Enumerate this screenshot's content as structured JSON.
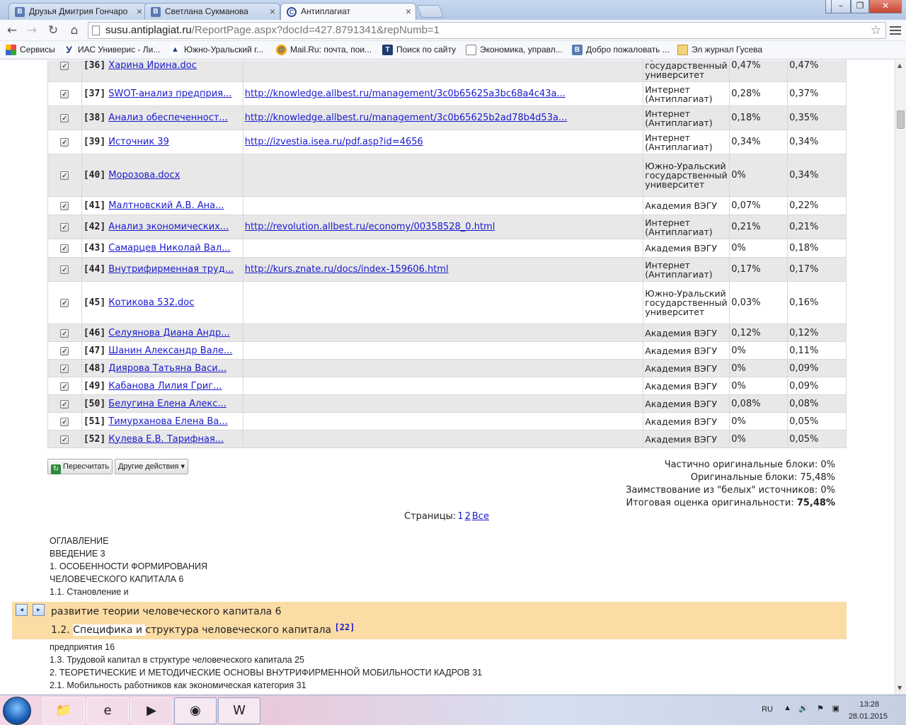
{
  "browser": {
    "tabs": [
      {
        "title": "Друзья Дмитрия Гончаро",
        "icon": "vk-icon",
        "active": false
      },
      {
        "title": "Светлана Сукманова",
        "icon": "vk-icon",
        "active": false
      },
      {
        "title": "Антиплагиат",
        "icon": "antiplagiat-icon",
        "active": true
      }
    ],
    "url_host": "susu.antiplagiat.ru",
    "url_path": "/ReportPage.aspx?docId=427.8791341&repNumb=1",
    "bookmarks": [
      {
        "label": "Сервисы",
        "icon": "apps-icon"
      },
      {
        "label": "ИАС Универис - Ли...",
        "icon": "yandex-icon"
      },
      {
        "label": "Южно-Уральский г...",
        "icon": "susu-icon"
      },
      {
        "label": "Mail.Ru: почта, пои...",
        "icon": "mailru-icon"
      },
      {
        "label": "Поиск по сайту",
        "icon": "t-icon"
      },
      {
        "label": "Экономика, управл...",
        "icon": "page-icon"
      },
      {
        "label": "Добро пожаловать ...",
        "icon": "vk-icon"
      },
      {
        "label": "Эл журнал Гусева",
        "icon": "folder-icon"
      }
    ]
  },
  "sources": [
    {
      "num": "[36]",
      "name": "Харина Ирина.doc",
      "url": "",
      "collection": "Уральский государственный университет",
      "share": "0,47%",
      "total": "0,47%",
      "alt": true
    },
    {
      "num": "[37]",
      "name": "SWOT-анализ предприя...",
      "url": "http://knowledge.allbest.ru/management/3c0b65625a3bc68a4c43a...",
      "collection": "Интернет (Антиплагиат)",
      "share": "0,28%",
      "total": "0,37%",
      "alt": false
    },
    {
      "num": "[38]",
      "name": "Анализ обеспеченност...",
      "url": "http://knowledge.allbest.ru/management/3c0b65625b2ad78b4d53a...",
      "collection": "Интернет (Антиплагиат)",
      "share": "0,18%",
      "total": "0,35%",
      "alt": true
    },
    {
      "num": "[39]",
      "name": "Источник 39",
      "url": "http://izvestia.isea.ru/pdf.asp?id=4656",
      "collection": "Интернет (Антиплагиат)",
      "share": "0,34%",
      "total": "0,34%",
      "alt": false
    },
    {
      "num": "[40]",
      "name": "Морозова.docx",
      "url": "",
      "collection": "Южно-Уральский государственный университет",
      "share": "0%",
      "total": "0,34%",
      "alt": true
    },
    {
      "num": "[41]",
      "name": "Малтновский А.В.  Ана...",
      "url": "",
      "collection": "Академия ВЭГУ",
      "share": "0,07%",
      "total": "0,22%",
      "alt": false
    },
    {
      "num": "[42]",
      "name": "Анализ экономических...",
      "url": "http://revolution.allbest.ru/economy/00358528_0.html",
      "collection": "Интернет (Антиплагиат)",
      "share": "0,21%",
      "total": "0,21%",
      "alt": true
    },
    {
      "num": "[43]",
      "name": "Самарцев Николай Вал...",
      "url": "",
      "collection": "Академия ВЭГУ",
      "share": "0%",
      "total": "0,18%",
      "alt": false
    },
    {
      "num": "[44]",
      "name": "Внутрифирменная труд...",
      "url": "http://kurs.znate.ru/docs/index-159606.html",
      "collection": "Интернет (Антиплагиат)",
      "share": "0,17%",
      "total": "0,17%",
      "alt": true
    },
    {
      "num": "[45]",
      "name": "Котикова 532.doc",
      "url": "",
      "collection": "Южно-Уральский государственный университет",
      "share": "0,03%",
      "total": "0,16%",
      "alt": false
    },
    {
      "num": "[46]",
      "name": "Селуянова Диана Андр...",
      "url": "",
      "collection": "Академия ВЭГУ",
      "share": "0,12%",
      "total": "0,12%",
      "alt": true
    },
    {
      "num": "[47]",
      "name": "Шанин Александр Вале...",
      "url": "",
      "collection": "Академия ВЭГУ",
      "share": "0%",
      "total": "0,11%",
      "alt": false
    },
    {
      "num": "[48]",
      "name": "Диярова Татьяна Васи...",
      "url": "",
      "collection": "Академия ВЭГУ",
      "share": "0%",
      "total": "0,09%",
      "alt": true
    },
    {
      "num": "[49]",
      "name": "Кабанова Лилия Григ...",
      "url": "",
      "collection": "Академия ВЭГУ",
      "share": "0%",
      "total": "0,09%",
      "alt": false
    },
    {
      "num": "[50]",
      "name": "Белугина Елена Алекс...",
      "url": "",
      "collection": "Академия ВЭГУ",
      "share": "0,08%",
      "total": "0,08%",
      "alt": true
    },
    {
      "num": "[51]",
      "name": "Тимурханова Елена Ва...",
      "url": "",
      "collection": "Академия ВЭГУ",
      "share": "0%",
      "total": "0,05%",
      "alt": false
    },
    {
      "num": "[52]",
      "name": "Кулева Е.В.  Тарифная...",
      "url": "",
      "collection": "Академия ВЭГУ",
      "share": "0%",
      "total": "0,05%",
      "alt": true
    }
  ],
  "actions": {
    "recalc": "Пересчитать",
    "other": "Другие действия"
  },
  "stats": {
    "partial_label": "Частично оригинальные блоки:",
    "partial_value": "0%",
    "original_label": "Оригинальные блоки:",
    "original_value": "75,48%",
    "white_label": "Заимствование из \"белых\" источников:",
    "white_value": "0%",
    "total_label": "Итоговая оценка оригинальности:",
    "total_value": "75,48%"
  },
  "pager": {
    "label": "Страницы:",
    "p1": "1",
    "p2": "2",
    "all": "Все"
  },
  "document": {
    "lines_top": [
      "ОГЛАВЛЕНИЕ",
      "ВВЕДЕНИЕ 3",
      "1. ОСОБЕННОСТИ ФОРМИРОВАНИЯ",
      "ЧЕЛОВЕЧЕСКОГО КАПИТАЛА 6",
      "1.1. Становление и"
    ],
    "highlight_line1": "развитие теории человеческого капитала 6",
    "highlight_line2_a": "1.2. ",
    "highlight_line2_b": " Специфика и ",
    "highlight_line2_c": "структура человеческого капитала",
    "highlight_ref": "[22]",
    "lines_bottom": [
      "предприятия 16",
      "1.3. Трудовой капитал в структуре человеческого капитала 25",
      "2. ТЕОРЕТИЧЕСКИЕ И МЕТОДИЧЕСКИЕ ОСНОВЫ ВНУТРИФИРМЕННОЙ МОБИЛЬНОСТИ КАДРОВ 31",
      "2.1. Мобильность работников как экономическая категория 31"
    ]
  },
  "taskbar": {
    "lang": "RU",
    "time": "13:28",
    "date": "28.01.2015"
  }
}
